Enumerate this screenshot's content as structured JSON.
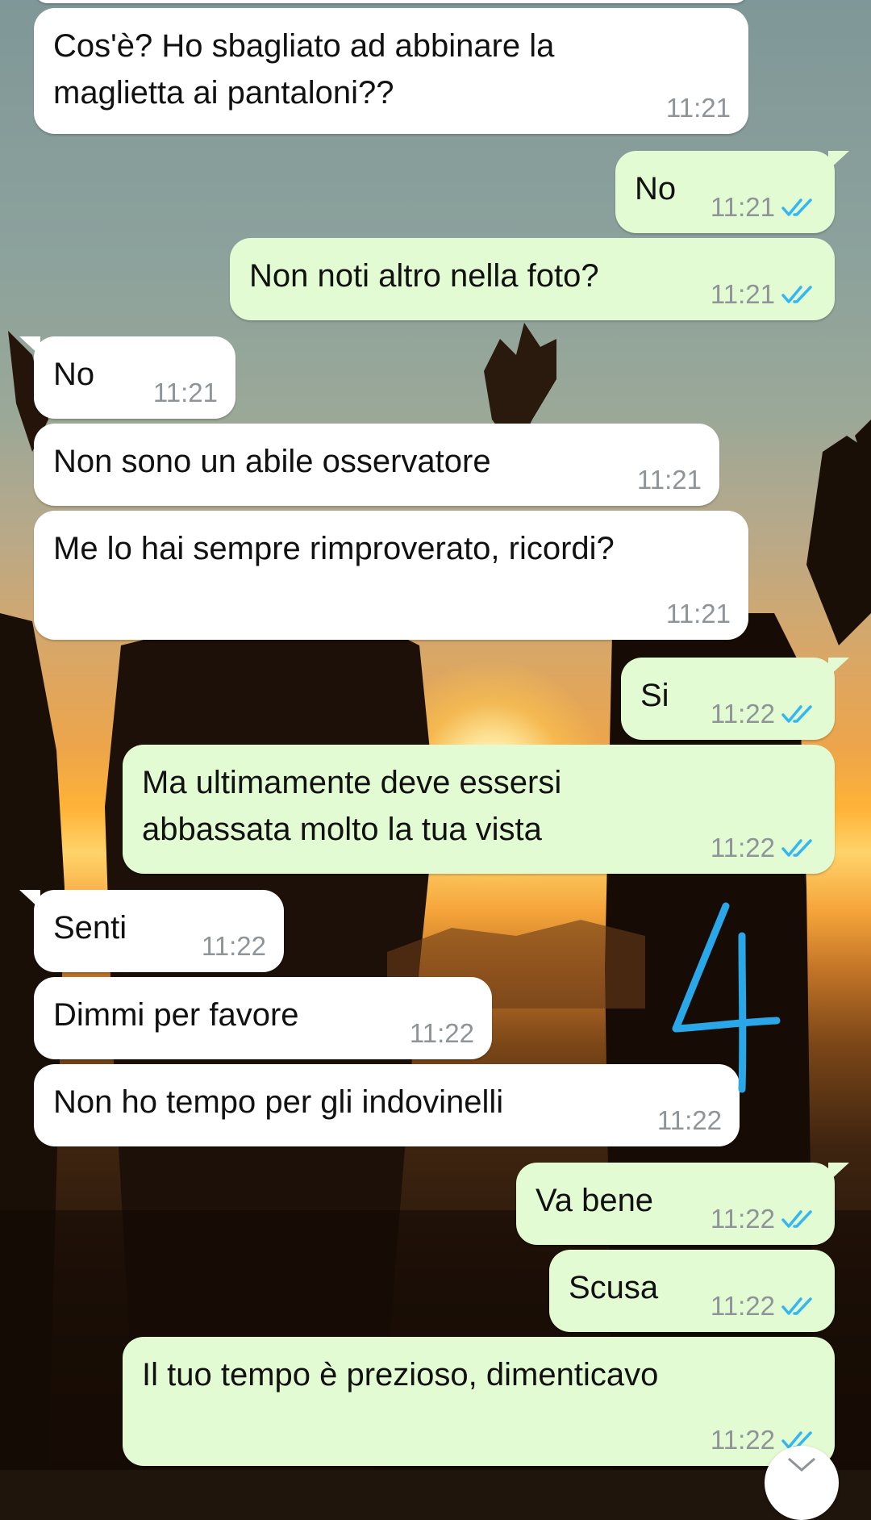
{
  "conversation": {
    "messages": [
      {
        "direction": "in",
        "text": "Cos'è? Ho sbagliato ad abbinare la\nmaglietta ai pantaloni??",
        "time": "11:21"
      },
      {
        "direction": "out",
        "text": "No",
        "time": "11:21",
        "status": "read"
      },
      {
        "direction": "out",
        "text": "Non noti altro nella foto?",
        "time": "11:21",
        "status": "read"
      },
      {
        "direction": "in",
        "text": "No",
        "time": "11:21"
      },
      {
        "direction": "in",
        "text": "Non sono un abile osservatore",
        "time": "11:21"
      },
      {
        "direction": "in",
        "text": "Me lo hai sempre rimproverato, ricordi?",
        "time": "11:21"
      },
      {
        "direction": "out",
        "text": "Si",
        "time": "11:22",
        "status": "read"
      },
      {
        "direction": "out",
        "text": "Ma ultimamente deve essersi\nabbassata molto la tua vista",
        "time": "11:22",
        "status": "read"
      },
      {
        "direction": "in",
        "text": "Senti",
        "time": "11:22"
      },
      {
        "direction": "in",
        "text": "Dimmi per favore",
        "time": "11:22"
      },
      {
        "direction": "in",
        "text": "Non ho tempo per gli indovinelli",
        "time": "11:22"
      },
      {
        "direction": "out",
        "text": "Va bene",
        "time": "11:22",
        "status": "read"
      },
      {
        "direction": "out",
        "text": "Scusa",
        "time": "11:22",
        "status": "read"
      },
      {
        "direction": "out",
        "text": "Il tuo tempo è prezioso, dimenticavo",
        "time": "11:22",
        "status": "read"
      }
    ]
  },
  "annotation": {
    "text": "4",
    "color": "#2aa7e8"
  },
  "colors": {
    "incoming_bubble": "#ffffff",
    "outgoing_bubble": "#e3fbd3",
    "timestamp": "#8e9498",
    "read_ticks": "#34b7f1"
  },
  "icons": {
    "read_ticks": "double-check-icon",
    "scroll_down": "chevron-down-icon"
  }
}
